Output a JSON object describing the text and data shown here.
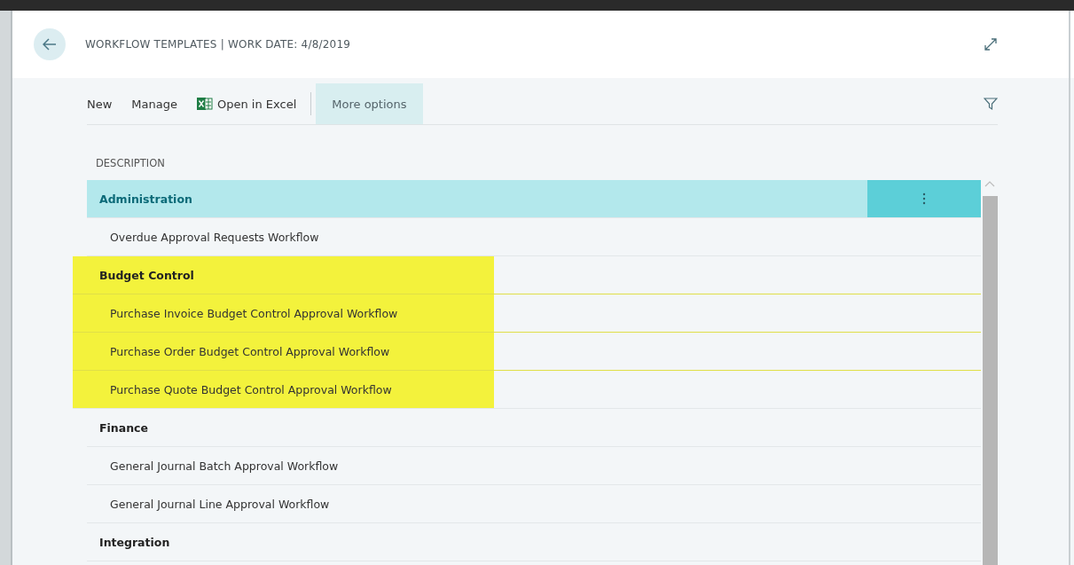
{
  "page": {
    "title": "WORKFLOW TEMPLATES | WORK DATE: 4/8/2019"
  },
  "toolbar": {
    "actions": [
      {
        "label": "New",
        "kind": "text"
      },
      {
        "label": "Manage",
        "kind": "text"
      },
      {
        "label": "Open in Excel",
        "kind": "excel"
      },
      {
        "label": "More options",
        "kind": "more"
      }
    ]
  },
  "table": {
    "columns": [
      "DESCRIPTION"
    ],
    "rows": [
      {
        "text": "Administration",
        "kind": "group",
        "selected": true,
        "highlighted": false
      },
      {
        "text": "Overdue Approval Requests Workflow",
        "kind": "item",
        "selected": false,
        "highlighted": false
      },
      {
        "text": "Budget Control",
        "kind": "group",
        "selected": false,
        "highlighted": true
      },
      {
        "text": "Purchase Invoice Budget Control Approval Workflow",
        "kind": "item",
        "selected": false,
        "highlighted": true
      },
      {
        "text": "Purchase Order Budget Control Approval Workflow",
        "kind": "item",
        "selected": false,
        "highlighted": true
      },
      {
        "text": "Purchase Quote Budget Control Approval Workflow",
        "kind": "item",
        "selected": false,
        "highlighted": true
      },
      {
        "text": "Finance",
        "kind": "group",
        "selected": false,
        "highlighted": false
      },
      {
        "text": "General Journal Batch Approval Workflow",
        "kind": "item",
        "selected": false,
        "highlighted": false
      },
      {
        "text": "General Journal Line Approval Workflow",
        "kind": "item",
        "selected": false,
        "highlighted": false
      },
      {
        "text": "Integration",
        "kind": "group",
        "selected": false,
        "highlighted": false
      }
    ]
  }
}
